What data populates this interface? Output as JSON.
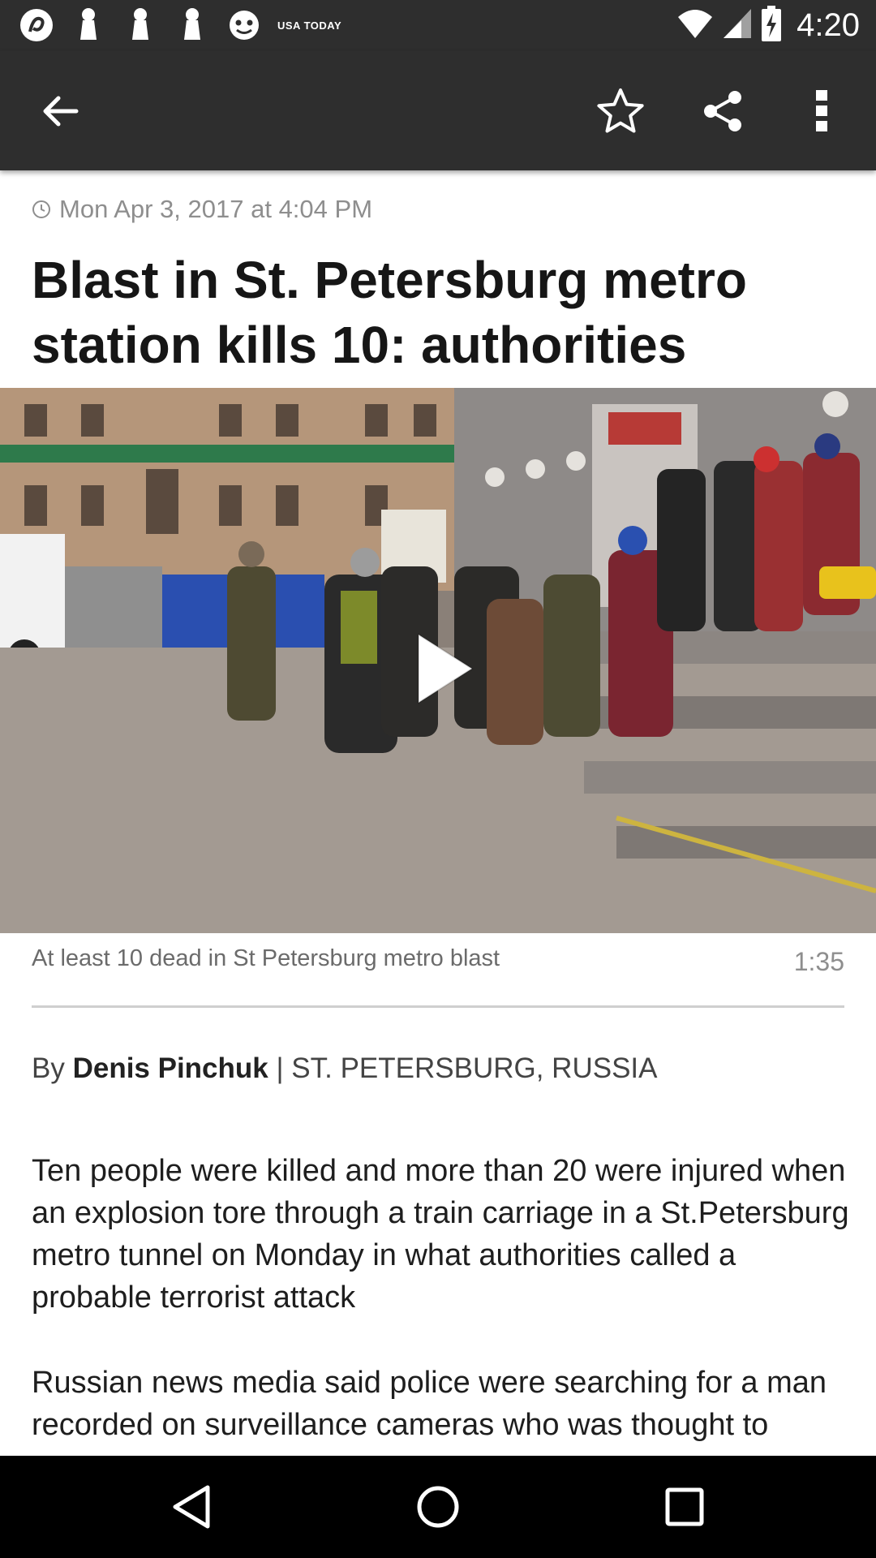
{
  "status_bar": {
    "time": "4:20",
    "brand_text": "USA TODAY",
    "left_icons": [
      "app-notification-icon",
      "pin-icon",
      "pin-icon",
      "pin-icon",
      "face-notification-icon",
      "usa-today-icon"
    ],
    "right_icons": [
      "wifi-icon",
      "cell-signal-icon",
      "battery-charging-icon"
    ]
  },
  "app_bar": {
    "icons": [
      "back-arrow-icon",
      "star-outline-icon",
      "share-icon",
      "more-vert-icon"
    ]
  },
  "article": {
    "timestamp": "Mon Apr 3, 2017 at 4:04 PM",
    "headline": "Blast in St. Petersburg metro station kills 10: authorities",
    "video": {
      "caption": "At least 10 dead in St Petersburg metro blast",
      "duration": "1:35"
    },
    "byline": {
      "prefix": "By ",
      "author": "Denis Pinchuk",
      "location": " | ST. PETERSBURG, RUSSIA"
    },
    "paragraphs": [
      "Ten people were killed and more than 20 were injured when an explosion tore through a train carriage in a St.Petersburg metro tunnel on Monday in what authorities called a probable terrorist attack",
      "Russian news media said police were searching for a man recorded on surveillance cameras who was thought to"
    ]
  },
  "nav_bar": {
    "icons": [
      "nav-back-icon",
      "nav-home-icon",
      "nav-recents-icon"
    ]
  },
  "colors": {
    "bar_background": "#2e2e2e",
    "nav_background": "#000000",
    "text_primary": "#1e1e1e",
    "text_muted": "#8e8e8e"
  }
}
